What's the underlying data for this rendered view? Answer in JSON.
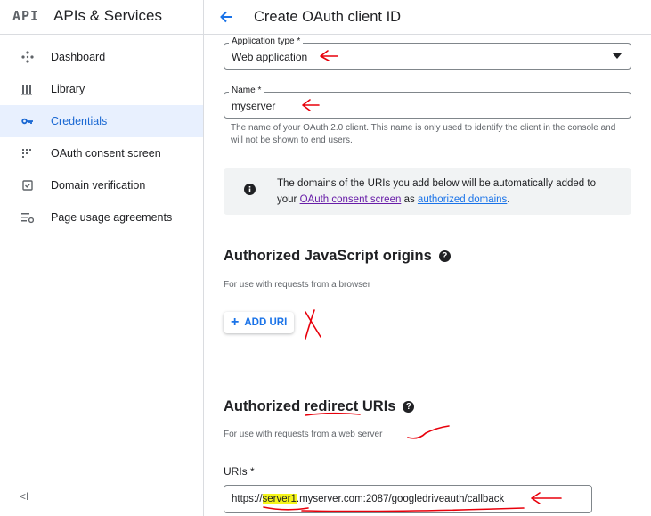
{
  "sidebar": {
    "logo": "API",
    "title": "APIs & Services",
    "items": [
      {
        "label": "Dashboard",
        "icon": "dashboard-icon"
      },
      {
        "label": "Library",
        "icon": "library-icon"
      },
      {
        "label": "Credentials",
        "icon": "key-icon",
        "active": true
      },
      {
        "label": "OAuth consent screen",
        "icon": "consent-icon"
      },
      {
        "label": "Domain verification",
        "icon": "verified-checkbox-icon"
      },
      {
        "label": "Page usage agreements",
        "icon": "settings-list-icon"
      }
    ],
    "collapse": "<I"
  },
  "header": {
    "title": "Create OAuth client ID"
  },
  "form": {
    "app_type": {
      "label": "Application type *",
      "value": "Web application"
    },
    "name": {
      "label": "Name *",
      "value": "myserver",
      "hint": "The name of your OAuth 2.0 client. This name is only used to identify the client in the console and will not be shown to end users."
    },
    "info": {
      "text1": "The domains of the URIs you add below will be automatically added to your ",
      "link1": "OAuth consent screen",
      "text2": " as ",
      "link2": "authorized domains",
      "text3": "."
    }
  },
  "js_origins": {
    "heading": "Authorized JavaScript origins",
    "sub": "For use with requests from a browser",
    "add_button": "ADD URI"
  },
  "redirect": {
    "heading_pre": "Authorized ",
    "heading_red": "redirect",
    "heading_post": " URIs",
    "sub": "For use with requests from a web server",
    "uris_label": "URIs *",
    "uri_pre": "https://",
    "uri_hl": "server1",
    "uri_post": ".myserver.com:2087/googledriveauth/callback"
  },
  "colors": {
    "accent": "#1a73e8",
    "active_bg": "#e8f0fe",
    "annotation": "#e8000b",
    "highlight": "#f5f51a"
  }
}
